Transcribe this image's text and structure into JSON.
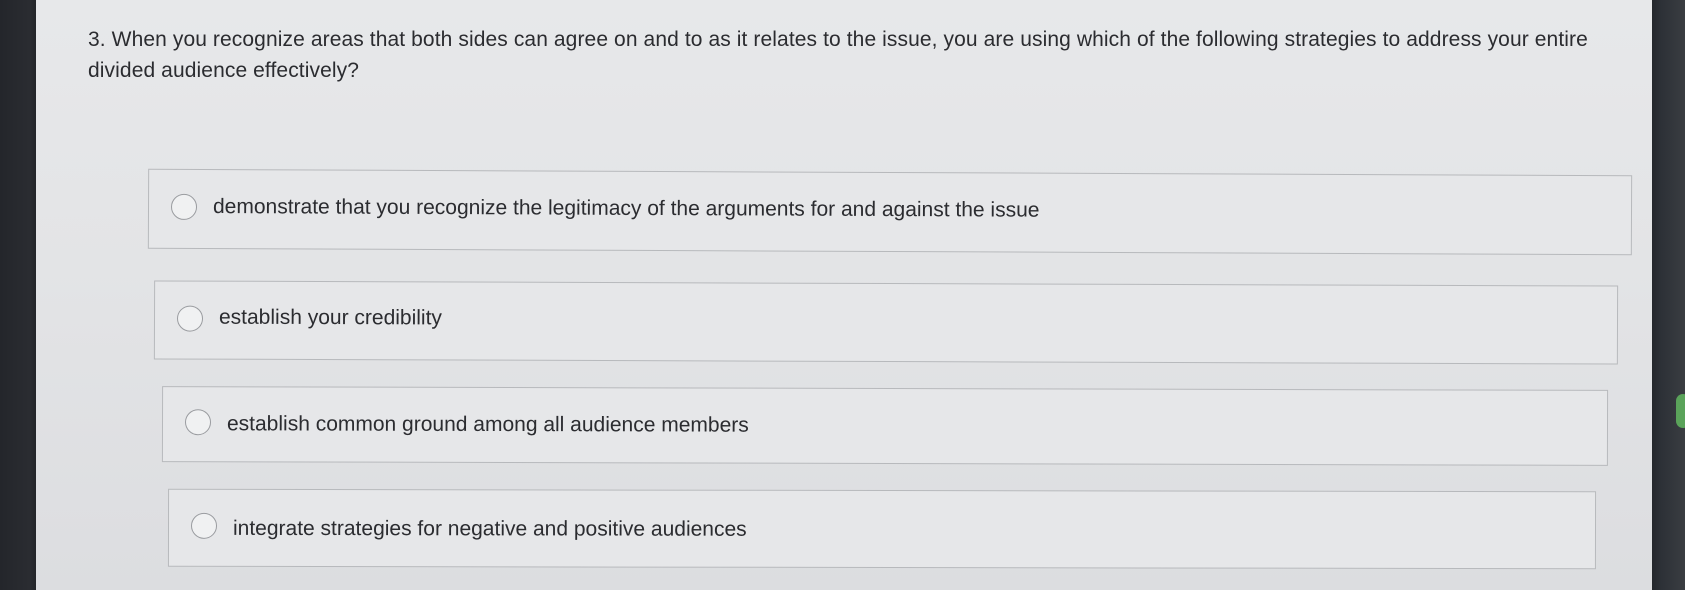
{
  "question": {
    "text": "3. When you recognize areas that both sides can agree on and to as it relates to the issue, you are using which of the following strategies to address your entire divided audience effectively?"
  },
  "options": [
    {
      "label": "demonstrate that you recognize the legitimacy of the arguments for and against the issue",
      "selected": false
    },
    {
      "label": "establish your credibility",
      "selected": false
    },
    {
      "label": "establish common ground among all audience members",
      "selected": false
    },
    {
      "label": "integrate strategies for negative and positive audiences",
      "selected": false
    }
  ],
  "colors": {
    "background": "#e4e5e7",
    "border": "#b7b9bc",
    "text": "#2b2c30",
    "bezel": "#1e2024"
  }
}
